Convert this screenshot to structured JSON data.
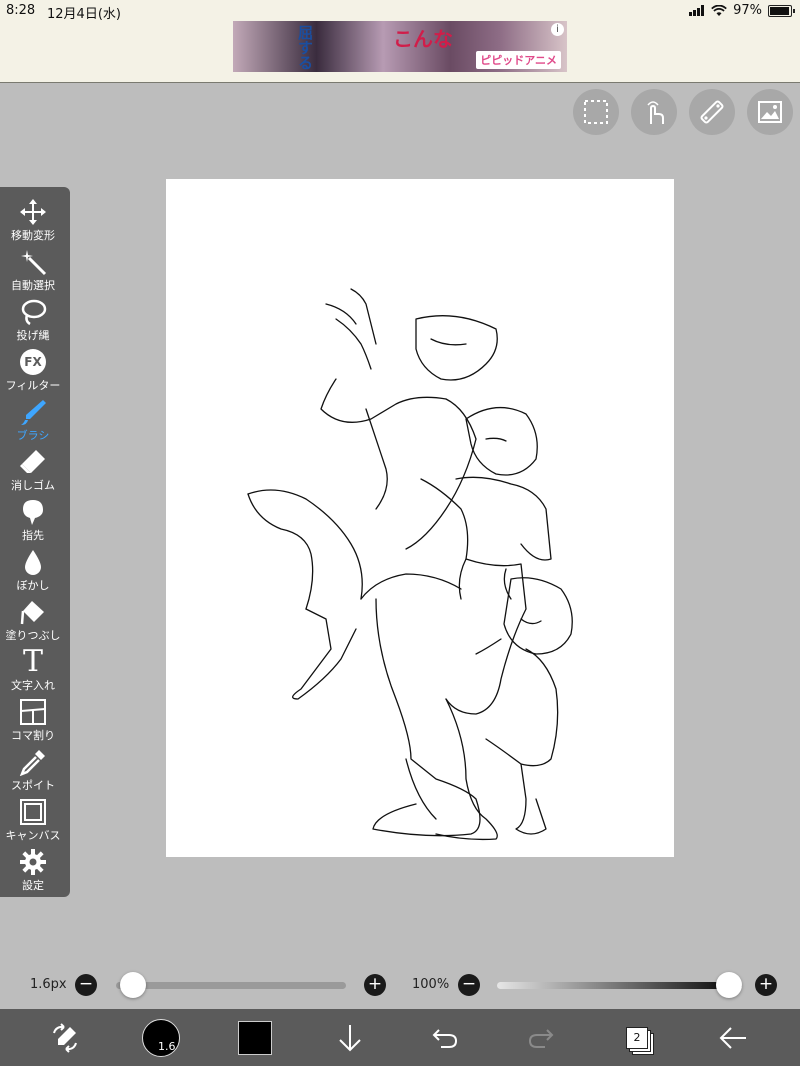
{
  "status_bar": {
    "time": "8:28",
    "date": "12月4日(水)",
    "battery_percent": "97%"
  },
  "ad": {
    "text_left": "屈する",
    "text_right": "こんな",
    "brand": "ピピッドアニメ",
    "info_icon": "info-icon"
  },
  "top_tools": [
    {
      "name": "selection-icon"
    },
    {
      "name": "touch-icon"
    },
    {
      "name": "ruler-icon"
    },
    {
      "name": "image-icon"
    }
  ],
  "toolbar": {
    "tools": [
      {
        "label": "移動変形",
        "icon": "move-icon"
      },
      {
        "label": "自動選択",
        "icon": "magic-wand-icon"
      },
      {
        "label": "投げ縄",
        "icon": "lasso-icon"
      },
      {
        "label": "フィルター",
        "icon": "fx-icon"
      },
      {
        "label": "ブラシ",
        "icon": "brush-icon",
        "active": true
      },
      {
        "label": "消しゴム",
        "icon": "eraser-icon"
      },
      {
        "label": "指先",
        "icon": "finger-icon"
      },
      {
        "label": "ぼかし",
        "icon": "blur-icon"
      },
      {
        "label": "塗りつぶし",
        "icon": "fill-icon"
      },
      {
        "label": "文字入れ",
        "icon": "text-icon"
      },
      {
        "label": "コマ割り",
        "icon": "panel-icon"
      },
      {
        "label": "スポイト",
        "icon": "eyedropper-icon"
      },
      {
        "label": "キャンバス",
        "icon": "canvas-icon"
      },
      {
        "label": "設定",
        "icon": "gear-icon"
      }
    ],
    "fx_text": "FX",
    "text_tool_glyph": "T"
  },
  "sliders": {
    "size_label": "1.6px",
    "size_fraction": 0.02,
    "opacity_label": "100%",
    "opacity_fraction": 1.0,
    "minus": "−",
    "plus": "+"
  },
  "bottom_bar": {
    "brush_size": "1.6",
    "color": "#000000",
    "layer_count": "2"
  },
  "colors": {
    "accent": "#3ea6ff",
    "toolbar_bg": "#5b5b5b",
    "workspace_bg": "#bdbdbd"
  }
}
